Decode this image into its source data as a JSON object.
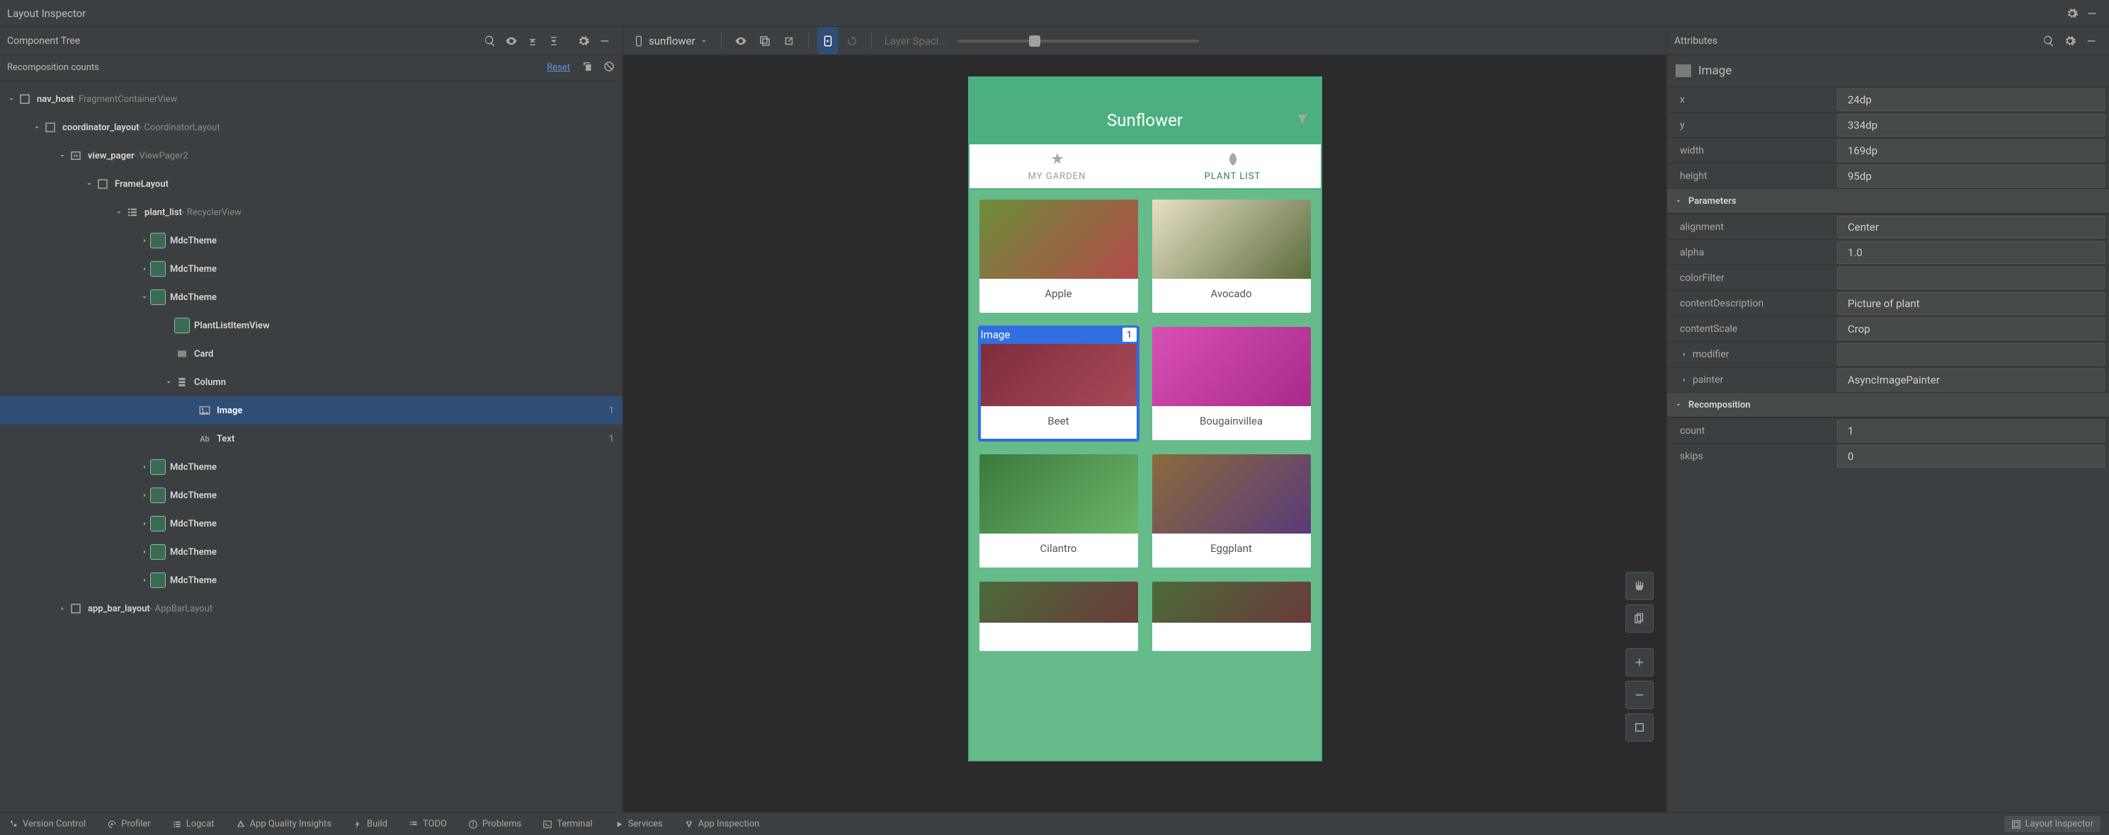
{
  "title": "Layout Inspector",
  "left": {
    "header": "Component Tree",
    "sub_label": "Recomposition counts",
    "reset": "Reset"
  },
  "tree": [
    {
      "depth": 1,
      "arrow": "down",
      "icon": "container",
      "main": "nav_host",
      "sec": " - FragmentContainerView"
    },
    {
      "depth": 2,
      "arrow": "down",
      "icon": "container",
      "main": "coordinator_layout",
      "sec": " - CoordinatorLayout"
    },
    {
      "depth": 3,
      "arrow": "down",
      "icon": "pager",
      "main": "view_pager",
      "sec": " - ViewPager2"
    },
    {
      "depth": 4,
      "arrow": "down",
      "icon": "frame",
      "main": "FrameLayout",
      "sec": ""
    },
    {
      "depth": 5,
      "arrow": "down",
      "icon": "list",
      "main": "plant_list",
      "sec": " - RecyclerView"
    },
    {
      "depth": 6,
      "arrow": "right",
      "icon": "compose",
      "main": "MdcTheme",
      "sec": ""
    },
    {
      "depth": 6,
      "arrow": "right",
      "icon": "compose",
      "main": "MdcTheme",
      "sec": ""
    },
    {
      "depth": 6,
      "arrow": "down",
      "icon": "compose",
      "main": "MdcTheme",
      "sec": ""
    },
    {
      "depth": 7,
      "arrow": "",
      "icon": "compose",
      "main": "PlantListItemView",
      "sec": ""
    },
    {
      "depth": 7,
      "arrow": "",
      "icon": "card",
      "main": "Card",
      "sec": ""
    },
    {
      "depth": 7,
      "arrow": "down",
      "icon": "column",
      "main": "Column",
      "sec": ""
    },
    {
      "depth": 8,
      "arrow": "",
      "icon": "image",
      "main": "Image",
      "sec": "",
      "count": "1",
      "selected": true
    },
    {
      "depth": 8,
      "arrow": "",
      "icon": "text",
      "main": "Text",
      "sec": "",
      "count": "1"
    },
    {
      "depth": 6,
      "arrow": "right",
      "icon": "compose",
      "main": "MdcTheme",
      "sec": ""
    },
    {
      "depth": 6,
      "arrow": "right",
      "icon": "compose",
      "main": "MdcTheme",
      "sec": ""
    },
    {
      "depth": 6,
      "arrow": "right",
      "icon": "compose",
      "main": "MdcTheme",
      "sec": ""
    },
    {
      "depth": 6,
      "arrow": "right",
      "icon": "compose",
      "main": "MdcTheme",
      "sec": ""
    },
    {
      "depth": 6,
      "arrow": "right",
      "icon": "compose",
      "main": "MdcTheme",
      "sec": ""
    },
    {
      "depth": 3,
      "arrow": "right",
      "icon": "container",
      "main": "app_bar_layout",
      "sec": " - AppBarLayout"
    }
  ],
  "center": {
    "device": "sunflower",
    "layer_label": "Layer Spaci...",
    "app_title": "Sunflower",
    "tab1": "MY GARDEN",
    "tab2": "PLANT LIST",
    "overlay_label": "Image",
    "overlay_count": "1",
    "plants": [
      "Apple",
      "Avocado",
      "Beet",
      "Bougainvillea",
      "Cilantro",
      "Eggplant"
    ],
    "plant_imgs": [
      "linear-gradient(135deg,#6b8e3a,#b54a4a)",
      "linear-gradient(135deg,#e8e0c8,#5a6b3a)",
      "linear-gradient(135deg,#7a2a3a,#a84a5a)",
      "linear-gradient(135deg,#d94fb5,#a82a8a)",
      "linear-gradient(135deg,#3a7a3a,#6bb56b)",
      "linear-gradient(135deg,#8a6b3a,#5a3a7a)"
    ]
  },
  "right": {
    "header": "Attributes",
    "type_name": "Image",
    "basic": [
      {
        "k": "x",
        "v": "24dp"
      },
      {
        "k": "y",
        "v": "334dp"
      },
      {
        "k": "width",
        "v": "169dp"
      },
      {
        "k": "height",
        "v": "95dp"
      }
    ],
    "section_params": "Parameters",
    "params": [
      {
        "k": "alignment",
        "v": "Center"
      },
      {
        "k": "alpha",
        "v": "1.0"
      },
      {
        "k": "colorFilter",
        "v": ""
      },
      {
        "k": "contentDescription",
        "v": "Picture of plant"
      },
      {
        "k": "contentScale",
        "v": "Crop"
      },
      {
        "k": "modifier",
        "v": "",
        "exp": true
      },
      {
        "k": "painter",
        "v": "AsyncImagePainter",
        "exp": true
      }
    ],
    "section_recomp": "Recomposition",
    "recomp": [
      {
        "k": "count",
        "v": "1"
      },
      {
        "k": "skips",
        "v": "0"
      }
    ]
  },
  "bottom": {
    "items": [
      "Version Control",
      "Profiler",
      "Logcat",
      "App Quality Insights",
      "Build",
      "TODO",
      "Problems",
      "Terminal",
      "Services",
      "App Inspection"
    ],
    "active": "Layout Inspector"
  }
}
